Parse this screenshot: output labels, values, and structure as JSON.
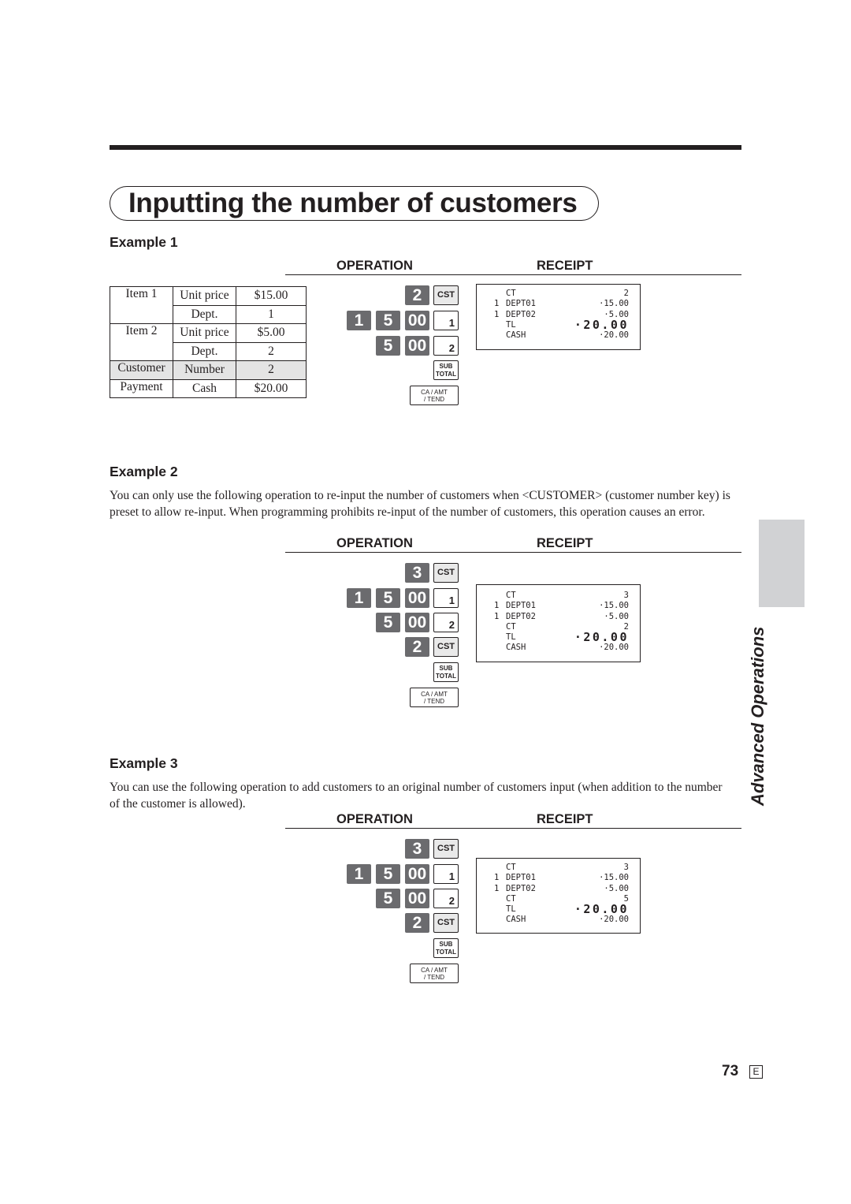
{
  "page": {
    "title": "Inputting the number of customers",
    "section_tab": "Advanced Operations",
    "page_number": "73",
    "language_mark": "E"
  },
  "labels": {
    "operation": "OPERATION",
    "receipt": "RECEIPT"
  },
  "keys": {
    "cst": "CST",
    "sub_total_top": "SUB",
    "sub_total_bottom": "TOTAL",
    "ca_top": "CA / AMT",
    "ca_bottom": "/ TEND",
    "dept1": "1",
    "dept2": "2"
  },
  "example1": {
    "heading": "Example 1",
    "table": [
      [
        "Item 1",
        "Unit price",
        "$15.00"
      ],
      [
        "",
        "Dept.",
        "1"
      ],
      [
        "Item 2",
        "Unit price",
        "$5.00"
      ],
      [
        "",
        "Dept.",
        "2"
      ],
      [
        "Customer",
        "Number",
        "2"
      ],
      [
        "Payment",
        "Cash",
        "$20.00"
      ]
    ],
    "operation": {
      "customer_count": "2",
      "item1_digits": [
        "1",
        "5",
        "00"
      ],
      "item2_digits": [
        "5",
        "00"
      ]
    },
    "receipt": [
      {
        "qty": "",
        "label": "CT",
        "value": "2"
      },
      {
        "qty": "1",
        "label": "DEPT01",
        "value": "·15.00"
      },
      {
        "qty": "1",
        "label": "DEPT02",
        "value": "·5.00"
      },
      {
        "qty": "",
        "label": "TL",
        "value": "·20.00",
        "big": true
      },
      {
        "qty": "",
        "label": "CASH",
        "value": "·20.00"
      }
    ]
  },
  "example2": {
    "heading": "Example 2",
    "description": "You can only use the following operation to re-input the number of customers when <CUSTOMER>  (customer number key) is preset to allow re-input. When programming prohibits re-input of the number of customers, this operation causes an error.",
    "operation": {
      "customer_count_first": "3",
      "item1_digits": [
        "1",
        "5",
        "00"
      ],
      "item2_digits": [
        "5",
        "00"
      ],
      "customer_count_second": "2"
    },
    "receipt": [
      {
        "qty": "",
        "label": "CT",
        "value": "3"
      },
      {
        "qty": "1",
        "label": "DEPT01",
        "value": "·15.00"
      },
      {
        "qty": "1",
        "label": "DEPT02",
        "value": "·5.00"
      },
      {
        "qty": "",
        "label": "CT",
        "value": "2"
      },
      {
        "qty": "",
        "label": "TL",
        "value": "·20.00",
        "big": true
      },
      {
        "qty": "",
        "label": "CASH",
        "value": "·20.00"
      }
    ]
  },
  "example3": {
    "heading": "Example 3",
    "description": "You can use the following operation to add customers to an original number of customers input (when addition to the number of the customer is allowed).",
    "operation": {
      "customer_count_first": "3",
      "item1_digits": [
        "1",
        "5",
        "00"
      ],
      "item2_digits": [
        "5",
        "00"
      ],
      "customer_count_second": "2"
    },
    "receipt": [
      {
        "qty": "",
        "label": "CT",
        "value": "3"
      },
      {
        "qty": "1",
        "label": "DEPT01",
        "value": "·15.00"
      },
      {
        "qty": "1",
        "label": "DEPT02",
        "value": "·5.00"
      },
      {
        "qty": "",
        "label": "CT",
        "value": "5"
      },
      {
        "qty": "",
        "label": "TL",
        "value": "·20.00",
        "big": true
      },
      {
        "qty": "",
        "label": "CASH",
        "value": "·20.00"
      }
    ]
  }
}
